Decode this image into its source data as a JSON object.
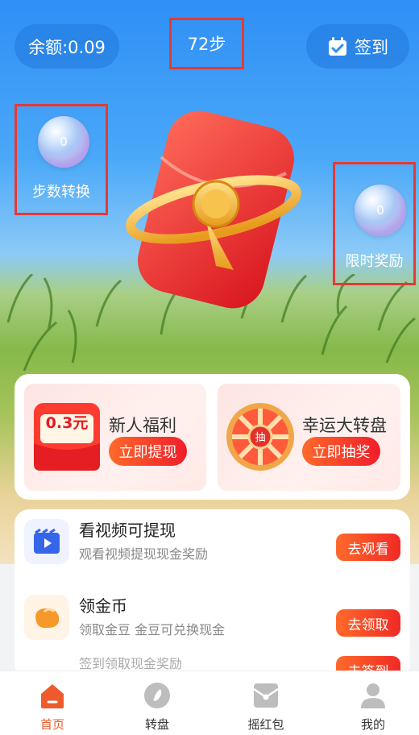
{
  "header": {
    "balance_text": "余额:0.09",
    "steps_text": "72步",
    "signin_label": "签到",
    "signin_icon": "calendar-check-icon"
  },
  "bubbles": [
    {
      "value": "0",
      "label": "步数转换"
    },
    {
      "value": "0",
      "label": "限时奖励"
    }
  ],
  "promo": {
    "newcomer": {
      "badge": "0.3元",
      "title": "新人福利",
      "button": "立即提现"
    },
    "wheel": {
      "badge": "抽",
      "title": "幸运大转盘",
      "button": "立即抽奖"
    }
  },
  "tasks": [
    {
      "icon": "video-play-icon",
      "title": "看视频可提现",
      "subtitle": "观看视频提现现金奖励",
      "button": "去观看"
    },
    {
      "icon": "gold-bean-icon",
      "title": "领金币",
      "subtitle": "领取金豆 金豆可兑换现金",
      "button": "去领取"
    },
    {
      "icon": "signin-icon",
      "title": "",
      "subtitle": "签到领取现金奖励",
      "button": "去签到"
    }
  ],
  "tabbar": [
    {
      "label": "首页",
      "icon": "home-icon",
      "active": true
    },
    {
      "label": "转盘",
      "icon": "wheel-icon",
      "active": false
    },
    {
      "label": "摇红包",
      "icon": "red-packet-icon",
      "active": false
    },
    {
      "label": "我的",
      "icon": "profile-icon",
      "active": false
    }
  ],
  "colors": {
    "accent": "#ee5a2c",
    "button_gradient_start": "#ff6a2b",
    "button_gradient_end": "#f01d2a",
    "highlight_border": "#e53935"
  }
}
